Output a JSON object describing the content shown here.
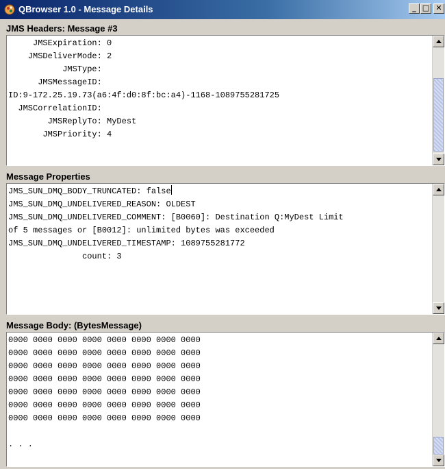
{
  "window": {
    "title": "QBrowser 1.0 - Message Details",
    "controls": {
      "minimize": "_",
      "maximize": "□",
      "close": "✕"
    }
  },
  "headers": {
    "label": "JMS Headers: Message #3",
    "lines": [
      "     JMSExpiration: 0",
      "    JMSDeliverMode: 2",
      "           JMSType:",
      "      JMSMessageID:",
      "ID:9-172.25.19.73(a6:4f:d0:8f:bc:a4)-1168-1089755281725",
      "  JMSCorrelationID:",
      "        JMSReplyTo: MyDest",
      "       JMSPriority: 4"
    ],
    "scroll_position": 0.55
  },
  "properties": {
    "label": "Message Properties",
    "lines": [
      "JMS_SUN_DMQ_BODY_TRUNCATED: false",
      "JMS_SUN_DMQ_UNDELIVERED_REASON: OLDEST",
      "JMS_SUN_DMQ_UNDELIVERED_COMMENT: [B0060]: Destination Q:MyDest Limit",
      "of 5 messages or [B0012]: unlimited bytes was exceeded",
      "JMS_SUN_DMQ_UNDELIVERED_TIMESTAMP: 1089755281772",
      "               count: 3"
    ]
  },
  "body": {
    "label": "Message Body: (BytesMessage)",
    "lines": [
      "0000 0000 0000 0000 0000 0000 0000 0000",
      "0000 0000 0000 0000 0000 0000 0000 0000",
      "0000 0000 0000 0000 0000 0000 0000 0000",
      "0000 0000 0000 0000 0000 0000 0000 0000",
      "0000 0000 0000 0000 0000 0000 0000 0000",
      "0000 0000 0000 0000 0000 0000 0000 0000",
      "0000 0000 0000 0000 0000 0000 0000 0000",
      "",
      ". . ."
    ]
  },
  "icons": {
    "app": "qbrowser-app-icon",
    "scroll_up": "arrow-up-icon",
    "scroll_down": "arrow-down-icon"
  },
  "colors": {
    "titlebar_start": "#0a246a",
    "titlebar_end": "#a6caf0",
    "face": "#d4d0c8",
    "thumb": "#b8c4e6"
  }
}
